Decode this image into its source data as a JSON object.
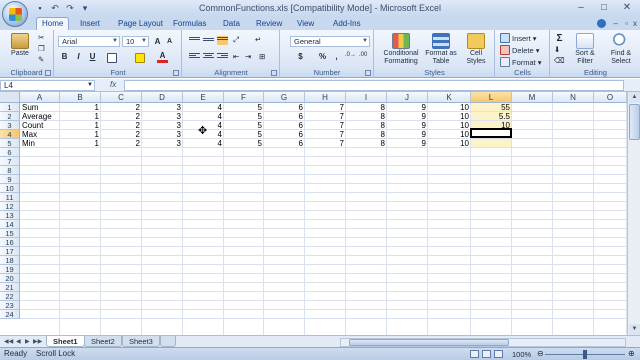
{
  "window": {
    "title": "CommonFunctions.xls  [Compatibility Mode] - Microsoft Excel",
    "qat_icons": [
      "save-icon",
      "undo-icon",
      "redo-icon",
      "customize-icon"
    ]
  },
  "ribbon_tabs": [
    "Home",
    "Insert",
    "Page Layout",
    "Formulas",
    "Data",
    "Review",
    "View",
    "Add-Ins"
  ],
  "ribbon": {
    "clipboard": {
      "paste_label": "Paste",
      "label": "Clipboard"
    },
    "font": {
      "name": "Arial",
      "size": "10",
      "bold": "B",
      "italic": "I",
      "underline": "U",
      "label": "Font"
    },
    "alignment": {
      "label": "Alignment"
    },
    "number": {
      "format": "General",
      "currency": "$",
      "percent": "%",
      "comma": ",",
      "label": "Number"
    },
    "styles": {
      "conditional": "Conditional Formatting",
      "format_table": "Format as Table",
      "cell_styles": "Cell Styles",
      "label": "Styles"
    },
    "cells": {
      "insert": "Insert",
      "delete": "Delete",
      "format": "Format",
      "label": "Cells"
    },
    "editing": {
      "sigma": "Σ",
      "sort": "Sort & Filter",
      "find": "Find & Select",
      "label": "Editing"
    }
  },
  "formula_bar": {
    "name_box": "L4",
    "fx": "fx",
    "formula": ""
  },
  "columns": [
    "A",
    "B",
    "C",
    "D",
    "E",
    "F",
    "G",
    "H",
    "I",
    "J",
    "K",
    "L",
    "M",
    "N",
    "O"
  ],
  "rows": [
    "1",
    "2",
    "3",
    "4",
    "5",
    "6",
    "7",
    "8",
    "9",
    "10",
    "11",
    "12",
    "13",
    "14",
    "15",
    "16",
    "17",
    "18",
    "19",
    "20",
    "21",
    "22",
    "23",
    "24"
  ],
  "table": [
    [
      "Sum",
      "1",
      "2",
      "3",
      "4",
      "5",
      "6",
      "7",
      "8",
      "9",
      "10",
      "55"
    ],
    [
      "Average",
      "1",
      "2",
      "3",
      "4",
      "5",
      "6",
      "7",
      "8",
      "9",
      "10",
      "5.5"
    ],
    [
      "Count",
      "1",
      "2",
      "3",
      "4",
      "5",
      "6",
      "7",
      "8",
      "9",
      "10",
      "10"
    ],
    [
      "Max",
      "1",
      "2",
      "3",
      "4",
      "5",
      "6",
      "7",
      "8",
      "9",
      "10",
      ""
    ],
    [
      "Min",
      "1",
      "2",
      "3",
      "4",
      "5",
      "6",
      "7",
      "8",
      "9",
      "10",
      ""
    ]
  ],
  "selected_cell": "L4",
  "sheets": [
    "Sheet1",
    "Sheet2",
    "Sheet3"
  ],
  "active_sheet": "Sheet1",
  "status": {
    "mode": "Ready",
    "scroll_lock": "Scroll Lock",
    "zoom": "100%"
  }
}
